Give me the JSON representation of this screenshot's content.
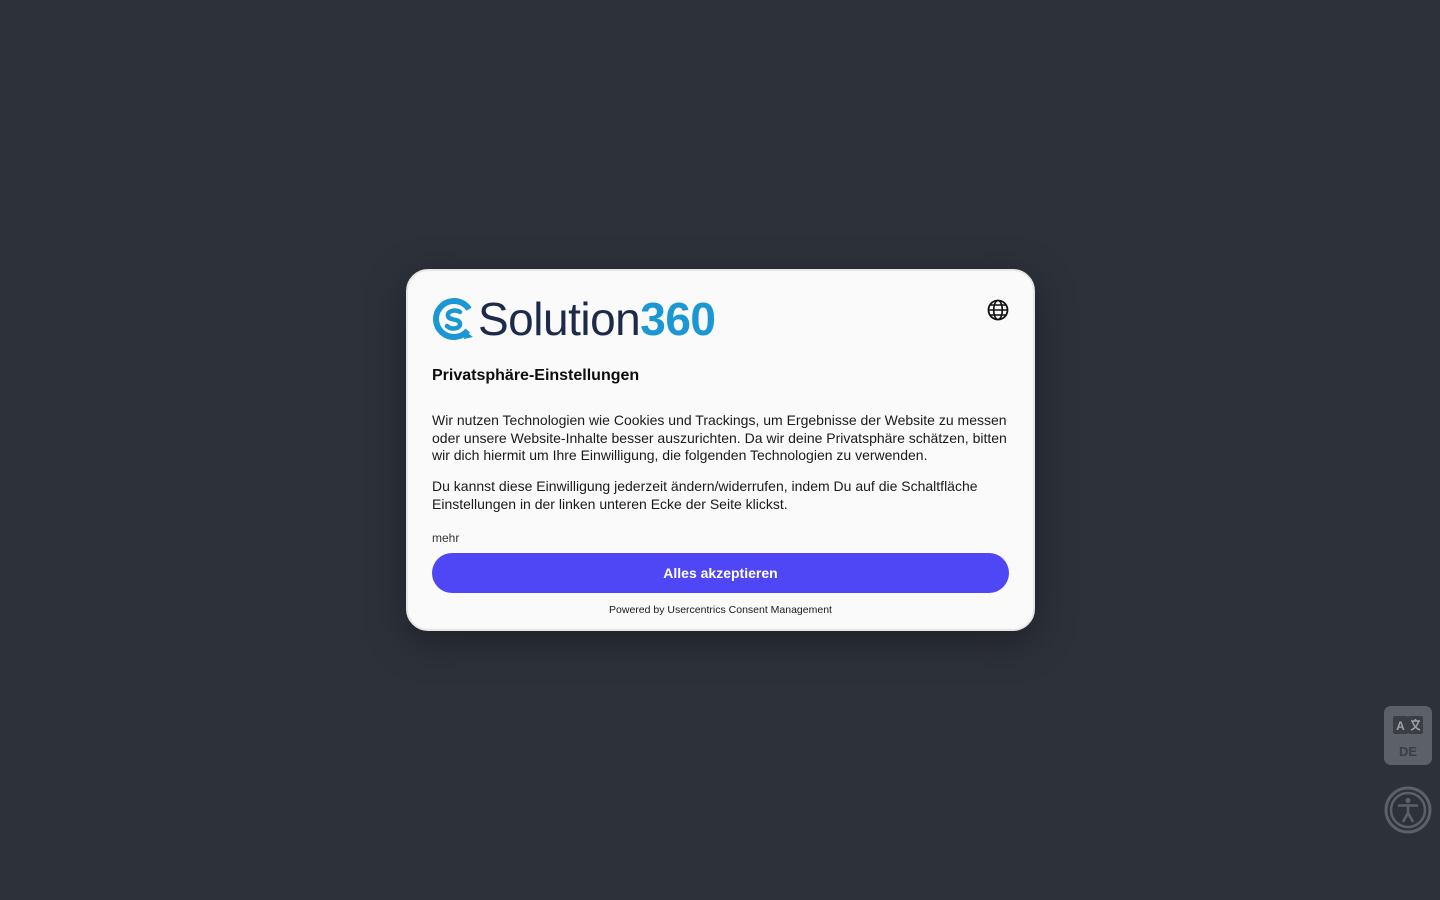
{
  "brand": {
    "word": "Solution",
    "number": "360",
    "word_color": "#1e2a4a",
    "accent_color": "#1b97d4"
  },
  "dialog": {
    "language_icon": "globe-icon",
    "title": "Privatsphäre-Einstellungen",
    "paragraph_1": "Wir nutzen Technologien wie Cookies und Trackings, um Ergebnisse der Website zu messen oder unsere Website-Inhalte besser auszurichten. Da wir deine Privatsphäre schätzen, bitten wir dich hiermit um Ihre Einwilligung, die folgenden Technologien zu verwenden.",
    "paragraph_2": "Du kannst diese Einwilligung jederzeit ändern/widerrufen, indem Du auf die Schaltfläche Einstellungen in der linken unteren Ecke der Seite klickst.",
    "more_link": "mehr",
    "accept_button": "Alles akzeptieren",
    "accept_color": "#4f46f5",
    "powered_by": "Powered by Usercentrics Consent Management"
  },
  "widgets": {
    "language_code": "DE",
    "language_icon": "translate-icon",
    "accessibility_icon": "accessibility-icon"
  }
}
